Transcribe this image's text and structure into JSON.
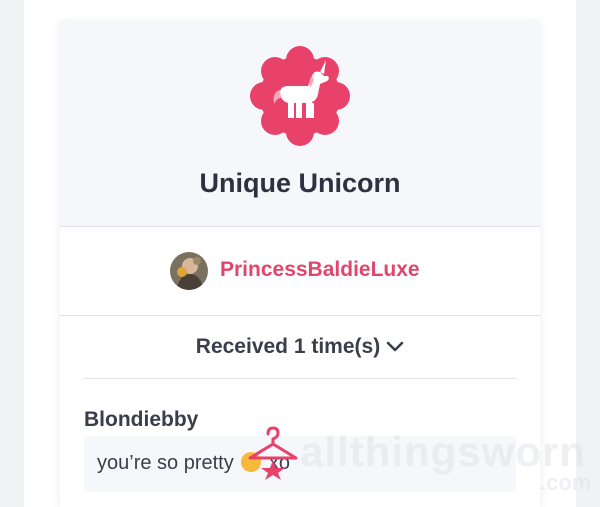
{
  "badge": {
    "title": "Unique Unicorn",
    "icon": "unicorn-icon",
    "accent_color": "#e8426b"
  },
  "giver": {
    "username": "PrincessBaldieLuxe",
    "avatar": "user-avatar",
    "name_color": "#e0466e"
  },
  "received": {
    "label": "Received 1 time(s)",
    "icon": "chevron-down-icon"
  },
  "comment": {
    "sender": "Blondiebby",
    "message_before_emoji": "you’re so pretty",
    "message_after_emoji": "xo"
  },
  "watermark": {
    "text": "allthingsworn",
    "suffix": ".com",
    "logo": "hanger-icon"
  }
}
